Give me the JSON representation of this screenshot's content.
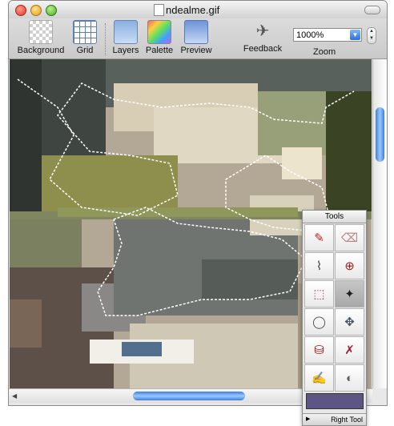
{
  "window": {
    "title": "ndealme.gif"
  },
  "toolbar": {
    "items": [
      {
        "label": "Background",
        "icon": "background-icon"
      },
      {
        "label": "Grid",
        "icon": "grid-icon"
      },
      {
        "label": "Layers",
        "icon": "layers-icon"
      },
      {
        "label": "Palette",
        "icon": "palette-icon"
      },
      {
        "label": "Preview",
        "icon": "preview-icon"
      },
      {
        "label": "Feedback",
        "icon": "feedback-icon"
      }
    ],
    "zoom": {
      "value": "1000%",
      "label": "Zoom"
    }
  },
  "tools": {
    "title": "Tools",
    "items": [
      {
        "name": "pencil-tool",
        "icon": "pencil-icon",
        "glyph": "✎"
      },
      {
        "name": "eraser-tool",
        "icon": "eraser-icon",
        "glyph": "⌫"
      },
      {
        "name": "eyedropper-tool",
        "icon": "eyedropper-icon",
        "glyph": "⌇"
      },
      {
        "name": "zoom-tool",
        "icon": "magnifier-icon",
        "glyph": "⊕"
      },
      {
        "name": "rect-select-tool",
        "icon": "rect-select-icon",
        "glyph": "⬚"
      },
      {
        "name": "magic-wand-tool",
        "icon": "magic-wand-icon",
        "glyph": "✦"
      },
      {
        "name": "lasso-tool",
        "icon": "lasso-icon",
        "glyph": "◯"
      },
      {
        "name": "move-tool",
        "icon": "move-icon",
        "glyph": "✥"
      },
      {
        "name": "fill-tool",
        "icon": "bucket-icon",
        "glyph": "⛁"
      },
      {
        "name": "replace-color-tool",
        "icon": "replace-color-icon",
        "glyph": "✗"
      },
      {
        "name": "draw-shape-tool",
        "icon": "shape-pencil-icon",
        "glyph": "✍"
      },
      {
        "name": "color-eraser-tool",
        "icon": "color-eraser-icon",
        "glyph": "◐"
      }
    ],
    "selected_index": 5,
    "current_color": "#5d5684",
    "right_tool_label": "Right Tool"
  },
  "colors": {
    "selection_border": "#ffffff",
    "canvas_bg": "#a89c88"
  }
}
